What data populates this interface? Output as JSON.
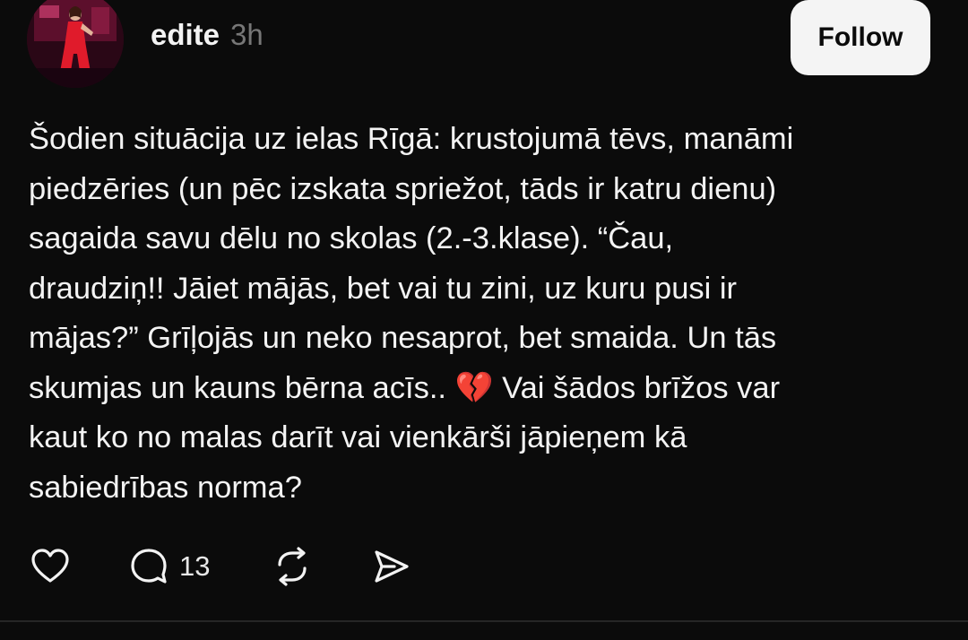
{
  "post": {
    "author": "edite",
    "time": "3h",
    "follow_label": "Follow",
    "text": "Šodien situācija uz ielas Rīgā: krustojumā tēvs, manāmi\npiedzēries (un pēc izskata spriežot, tāds ir katru dienu)\nsagaida savu dēlu no skolas (2.-3.klase). “Čau,\ndraudziņ!! Jāiet mājās, bet vai tu zini, uz kuru pusi ir\nmājas?” Grīļojās un neko nesaprot, bet smaida. Un tās\nskumjas un kauns bērna acīs.. 💔 Vai šādos brīžos var\nkaut ko no malas darīt vai vienkārši jāpieņem kā\nsabiedrības norma?",
    "actions": {
      "like_icon": "heart-icon",
      "reply_icon": "comment-bubble-icon",
      "reply_count": "13",
      "repost_icon": "repost-icon",
      "share_icon": "send-icon"
    }
  },
  "colors": {
    "background": "#0b0b0b",
    "text": "#f3f3f3",
    "muted": "#777777",
    "button_bg": "#f4f4f4",
    "button_text": "#0b0b0b",
    "divider": "#262626"
  }
}
